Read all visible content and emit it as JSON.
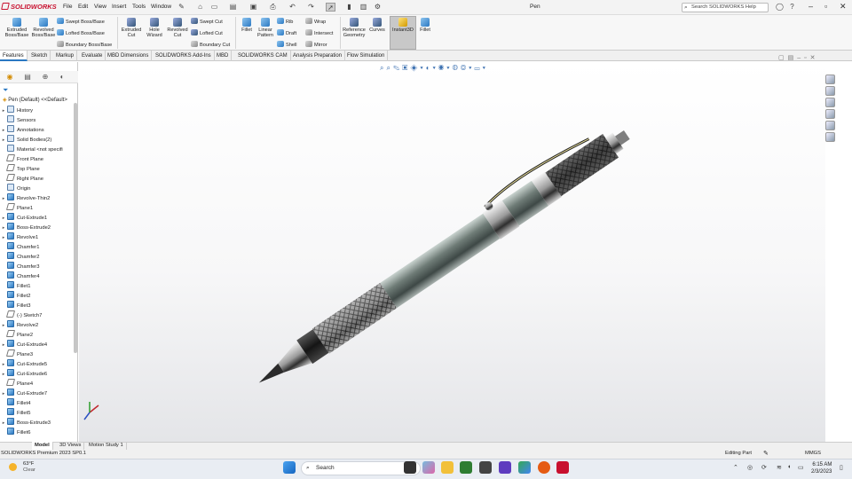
{
  "app": {
    "logo": "SOLIDWORKS",
    "document_title": "Pen",
    "search_placeholder": "Search SOLIDWORKS Help"
  },
  "menu": [
    "File",
    "Edit",
    "View",
    "Insert",
    "Tools",
    "Window"
  ],
  "ribbon": {
    "extruded_boss": "Extruded Boss/Base",
    "revolved_boss": "Revolved Boss/Base",
    "swept_boss": "Swept Boss/Base",
    "lofted_boss": "Lofted Boss/Base",
    "boundary_boss": "Boundary Boss/Base",
    "extruded_cut": "Extruded Cut",
    "hole_wizard": "Hole Wizard",
    "revolved_cut": "Revolved Cut",
    "swept_cut": "Swept Cut",
    "lofted_cut": "Lofted Cut",
    "boundary_cut": "Boundary Cut",
    "fillet": "Fillet",
    "linear_pattern": "Linear Pattern",
    "rib": "Rib",
    "draft": "Draft",
    "shell": "Shell",
    "wrap": "Wrap",
    "intersect": "Intersect",
    "mirror": "Mirror",
    "reference_geometry": "Reference Geometry",
    "curves": "Curves",
    "instant3d": "Instant3D",
    "fillet2": "Fillet"
  },
  "tabs": [
    "Features",
    "Sketch",
    "Markup",
    "Evaluate",
    "MBD Dimensions",
    "SOLIDWORKS Add-Ins",
    "MBD",
    "SOLIDWORKS CAM",
    "Analysis Preparation",
    "Flow Simulation"
  ],
  "tree": {
    "root": "Pen (Default) <<Default>",
    "items": [
      {
        "label": "History",
        "exp": "▸",
        "kind": "misc"
      },
      {
        "label": "Sensors",
        "exp": "",
        "kind": "misc"
      },
      {
        "label": "Annotations",
        "exp": "▸",
        "kind": "misc"
      },
      {
        "label": "Solid Bodies(2)",
        "exp": "▸",
        "kind": "misc"
      },
      {
        "label": "Material <not specifi",
        "exp": "",
        "kind": "misc"
      },
      {
        "label": "Front Plane",
        "exp": "",
        "kind": "plane"
      },
      {
        "label": "Top Plane",
        "exp": "",
        "kind": "plane"
      },
      {
        "label": "Right Plane",
        "exp": "",
        "kind": "plane"
      },
      {
        "label": "Origin",
        "exp": "",
        "kind": "misc"
      },
      {
        "label": "Revolve-Thin2",
        "exp": "▸",
        "kind": "feat"
      },
      {
        "label": "Plane1",
        "exp": "",
        "kind": "plane"
      },
      {
        "label": "Cut-Extrude1",
        "exp": "▸",
        "kind": "feat"
      },
      {
        "label": "Boss-Extrude2",
        "exp": "▸",
        "kind": "feat"
      },
      {
        "label": "Revolve1",
        "exp": "▸",
        "kind": "feat"
      },
      {
        "label": "Chamfer1",
        "exp": "",
        "kind": "feat"
      },
      {
        "label": "Chamfer2",
        "exp": "",
        "kind": "feat"
      },
      {
        "label": "Chamfer3",
        "exp": "",
        "kind": "feat"
      },
      {
        "label": "Chamfer4",
        "exp": "",
        "kind": "feat"
      },
      {
        "label": "Fillet1",
        "exp": "",
        "kind": "feat"
      },
      {
        "label": "Fillet2",
        "exp": "",
        "kind": "feat"
      },
      {
        "label": "Fillet3",
        "exp": "",
        "kind": "feat"
      },
      {
        "label": "(-) Sketch7",
        "exp": "",
        "kind": "plane"
      },
      {
        "label": "Revolve2",
        "exp": "▸",
        "kind": "feat"
      },
      {
        "label": "Plane2",
        "exp": "",
        "kind": "plane"
      },
      {
        "label": "Cut-Extrude4",
        "exp": "▸",
        "kind": "feat"
      },
      {
        "label": "Plane3",
        "exp": "",
        "kind": "plane"
      },
      {
        "label": "Cut-Extrude5",
        "exp": "▸",
        "kind": "feat"
      },
      {
        "label": "Cut-Extrude6",
        "exp": "▸",
        "kind": "feat"
      },
      {
        "label": "Plane4",
        "exp": "",
        "kind": "plane"
      },
      {
        "label": "Cut-Extrude7",
        "exp": "▸",
        "kind": "feat"
      },
      {
        "label": "Fillet4",
        "exp": "",
        "kind": "feat"
      },
      {
        "label": "Fillet5",
        "exp": "",
        "kind": "feat"
      },
      {
        "label": "Boss-Extrude3",
        "exp": "▸",
        "kind": "feat"
      },
      {
        "label": "Fillet6",
        "exp": "",
        "kind": "feat"
      }
    ]
  },
  "bottom_tabs": [
    "Model",
    "3D Views",
    "Motion Study 1"
  ],
  "status": {
    "left": "SOLIDWORKS Premium 2023 SP0.1",
    "editing": "Editing Part",
    "units": "MMGS"
  },
  "taskbar": {
    "temp": "63°F",
    "condition": "Clear",
    "search": "Search",
    "time": "6:15 AM",
    "date": "2/3/2023"
  }
}
